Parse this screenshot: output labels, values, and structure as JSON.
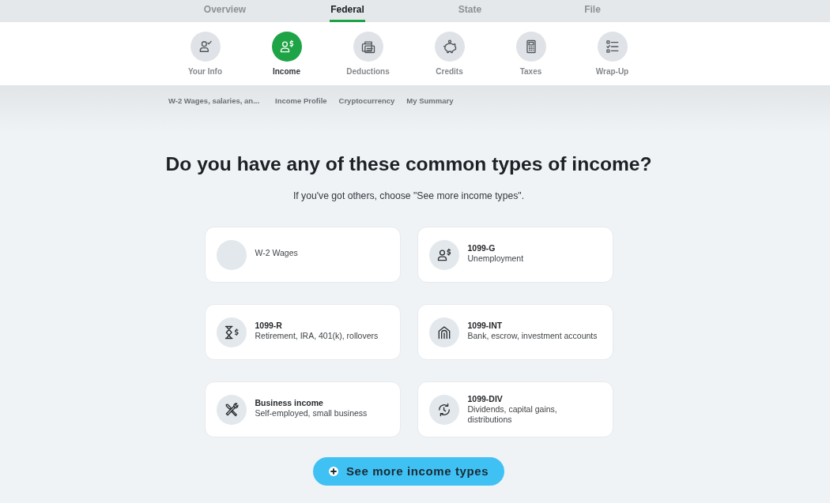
{
  "top_tabs": [
    {
      "label": "Overview",
      "selected": false
    },
    {
      "label": "Federal",
      "selected": true
    },
    {
      "label": "State",
      "selected": false
    },
    {
      "label": "File",
      "selected": false
    }
  ],
  "steps": [
    {
      "label": "Your Info",
      "selected": false
    },
    {
      "label": "Income",
      "selected": true
    },
    {
      "label": "Deductions",
      "selected": false
    },
    {
      "label": "Credits",
      "selected": false
    },
    {
      "label": "Taxes",
      "selected": false
    },
    {
      "label": "Wrap-Up",
      "selected": false
    }
  ],
  "subnav": [
    "W-2 Wages, salaries, an...",
    "Income Profile",
    "Cryptocurrency",
    "My Summary"
  ],
  "heading": "Do you have any of these common types of income?",
  "subheading": "If you've got others, choose \"See more income types\".",
  "income_types": [
    {
      "description": "W-2 Wages"
    },
    {
      "title": "1099-G",
      "description": "Unemployment"
    },
    {
      "title": "1099-R",
      "description": "Retirement, IRA, 401(k), rollovers"
    },
    {
      "title": "1099-INT",
      "description": "Bank, escrow, investment accounts"
    },
    {
      "title": "Business income",
      "description": "Self-employed, small business"
    },
    {
      "title": "1099-DIV",
      "description": "Dividends, capital gains, distributions"
    }
  ],
  "more_button": {
    "label": "See more income types"
  }
}
